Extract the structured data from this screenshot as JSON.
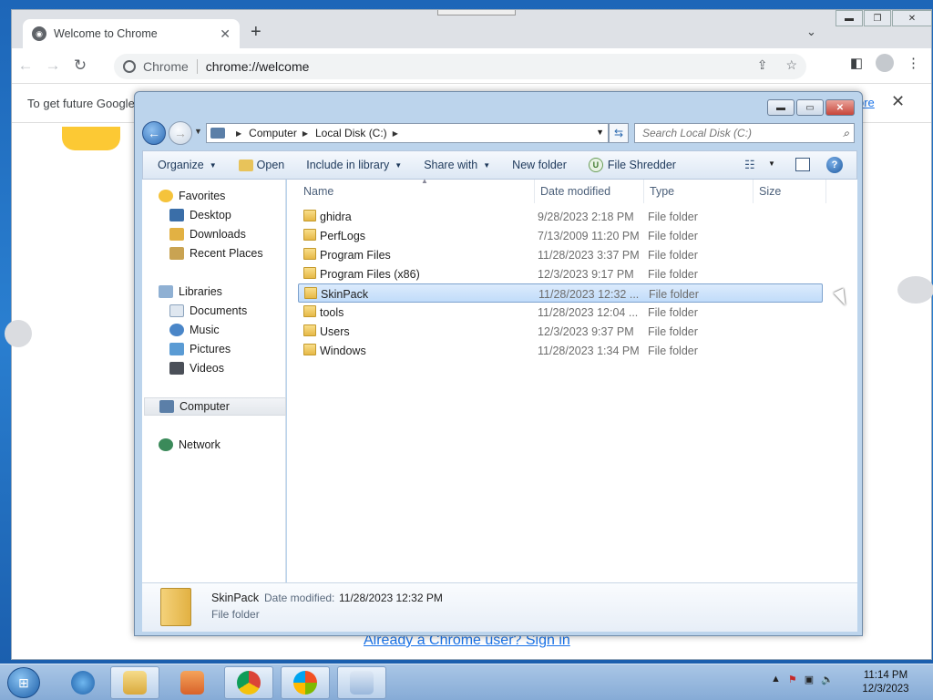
{
  "chrome": {
    "tab_title": "Welcome to Chrome",
    "omnibox_chip": "Chrome",
    "omnibox_url": "chrome://welcome",
    "infobar_text": "To get future Google",
    "infobar_more": "ore",
    "signin_link": "Already a Chrome user? Sign in"
  },
  "explorer": {
    "address": {
      "computer": "Computer",
      "disk": "Local Disk (C:)"
    },
    "search_placeholder": "Search Local Disk (C:)",
    "commands": {
      "organize": "Organize",
      "open": "Open",
      "include": "Include in library",
      "share": "Share with",
      "newfolder": "New folder",
      "shredder": "File Shredder"
    },
    "nav": {
      "favorites": "Favorites",
      "desktop": "Desktop",
      "downloads": "Downloads",
      "recent": "Recent Places",
      "libraries": "Libraries",
      "documents": "Documents",
      "music": "Music",
      "pictures": "Pictures",
      "videos": "Videos",
      "computer": "Computer",
      "network": "Network"
    },
    "columns": {
      "name": "Name",
      "date": "Date modified",
      "type": "Type",
      "size": "Size"
    },
    "files": [
      {
        "name": "ghidra",
        "date": "9/28/2023 2:18 PM",
        "type": "File folder"
      },
      {
        "name": "PerfLogs",
        "date": "7/13/2009 11:20 PM",
        "type": "File folder"
      },
      {
        "name": "Program Files",
        "date": "11/28/2023 3:37 PM",
        "type": "File folder"
      },
      {
        "name": "Program Files (x86)",
        "date": "12/3/2023 9:17 PM",
        "type": "File folder"
      },
      {
        "name": "SkinPack",
        "date": "11/28/2023 12:32 ...",
        "type": "File folder"
      },
      {
        "name": "tools",
        "date": "11/28/2023 12:04 ...",
        "type": "File folder"
      },
      {
        "name": "Users",
        "date": "12/3/2023 9:37 PM",
        "type": "File folder"
      },
      {
        "name": "Windows",
        "date": "11/28/2023 1:34 PM",
        "type": "File folder"
      }
    ],
    "details": {
      "name": "SkinPack",
      "date_label": "Date modified:",
      "date_value": "11/28/2023 12:32 PM",
      "type": "File folder"
    }
  },
  "taskbar": {
    "time": "11:14 PM",
    "date": "12/3/2023"
  }
}
